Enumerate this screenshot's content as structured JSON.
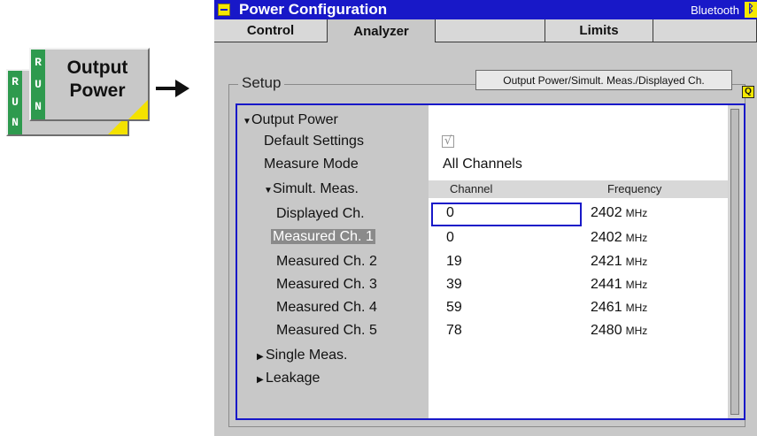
{
  "softkey": {
    "run_letters": [
      "R",
      "U",
      "N"
    ],
    "label_line1": "Output",
    "label_line2": "Power",
    "back_label": "Power"
  },
  "window": {
    "title": "Power Configuration",
    "mode": "Bluetooth"
  },
  "tabs": [
    {
      "label": "Control"
    },
    {
      "label": "Analyzer"
    },
    {
      "label": ""
    },
    {
      "label": "Limits"
    },
    {
      "label": ""
    }
  ],
  "setup": {
    "label": "Setup",
    "path": "Output Power/Simult. Meas./Displayed Ch.",
    "q_icon": "Q"
  },
  "tree": [
    {
      "label": "Output Power",
      "expanded": true,
      "level": 0
    },
    {
      "label": "Default Settings",
      "level": 1
    },
    {
      "label": "Measure Mode",
      "level": 1
    },
    {
      "label": "Simult. Meas.",
      "expanded": true,
      "level": 1
    },
    {
      "label": "Displayed Ch.",
      "level": 2
    },
    {
      "label": "Measured Ch. 1",
      "level": 2,
      "selected": true
    },
    {
      "label": "Measured Ch. 2",
      "level": 2
    },
    {
      "label": "Measured Ch. 3",
      "level": 2
    },
    {
      "label": "Measured Ch. 4",
      "level": 2
    },
    {
      "label": "Measured Ch. 5",
      "level": 2
    },
    {
      "label": "Single Meas.",
      "expanded": false,
      "level": 0
    },
    {
      "label": "Leakage",
      "expanded": false,
      "level": 0
    }
  ],
  "values": {
    "default_settings_checked": true,
    "checkmark": "√",
    "measure_mode": "All Channels"
  },
  "table": {
    "headers": {
      "channel": "Channel",
      "frequency": "Frequency"
    },
    "unit": "MHz",
    "rows": [
      {
        "channel": "0",
        "frequency": "2402"
      },
      {
        "channel": "0",
        "frequency": "2402"
      },
      {
        "channel": "19",
        "frequency": "2421"
      },
      {
        "channel": "39",
        "frequency": "2441"
      },
      {
        "channel": "59",
        "frequency": "2461"
      },
      {
        "channel": "78",
        "frequency": "2480"
      }
    ]
  },
  "colors": {
    "title_bar": "#1818c8",
    "accent_yellow": "#f5e800",
    "run_green": "#2e9a4e"
  }
}
